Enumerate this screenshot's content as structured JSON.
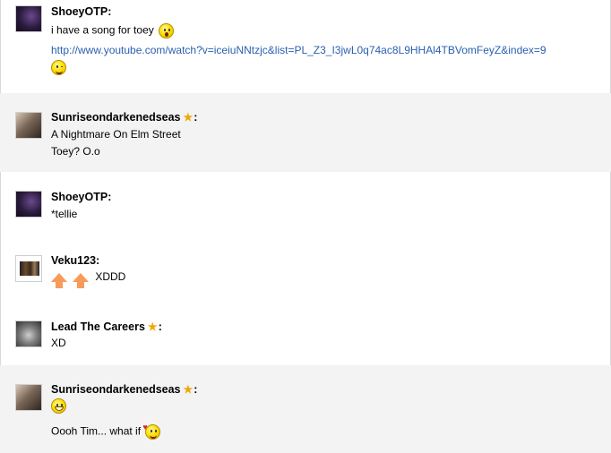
{
  "posts": [
    {
      "author": "ShoeyOTP:",
      "lines": [
        "i have a song for toey",
        "http://www.youtube.com/watch?v=iceiuNNtzjc&list=PL_Z3_I3jwL0q74ac8L9HHAl4TBVomFeyZ&index=9"
      ]
    },
    {
      "author": "Sunriseondarkenedseas",
      "star": "★",
      "colon": ":",
      "lines": [
        "A Nightmare On Elm Street",
        "Toey? O.o"
      ]
    },
    {
      "author": "ShoeyOTP:",
      "lines": [
        "*tellie"
      ]
    },
    {
      "author": "Veku123:",
      "lines": [
        "XDDD"
      ]
    },
    {
      "author": "Lead The Careers",
      "star": "★",
      "colon": ":",
      "lines": [
        "XD"
      ]
    },
    {
      "author": "Sunriseondarkenedseas",
      "star": "★",
      "colon": ":",
      "lines": [
        "Oooh Tim... what if"
      ]
    }
  ],
  "icons": {
    "surprised": "surprised-smiley-icon",
    "wink": "wink-smiley-icon",
    "grin": "grin-smiley-icon",
    "love": "love-smiley-icon",
    "upvote": "up-arrow-icon"
  },
  "colors": {
    "link": "#2a5fb0",
    "alt_row": "#f3f3f3",
    "star": "#f0a800",
    "arrow": "#f79a5a"
  }
}
